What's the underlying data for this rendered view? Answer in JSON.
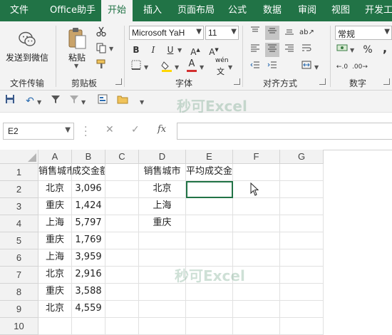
{
  "tabs": [
    {
      "label": "文件",
      "active": false
    },
    {
      "label": "Office助手",
      "active": false
    },
    {
      "label": "开始",
      "active": true
    },
    {
      "label": "插入",
      "active": false
    },
    {
      "label": "页面布局",
      "active": false
    },
    {
      "label": "公式",
      "active": false
    },
    {
      "label": "数据",
      "active": false
    },
    {
      "label": "审阅",
      "active": false
    },
    {
      "label": "视图",
      "active": false
    },
    {
      "label": "开发工",
      "active": false
    }
  ],
  "ribbon": {
    "send_to_wechat": "发送到微信",
    "file_transfer": "文件传输",
    "paste": "粘贴",
    "clipboard": "剪贴板",
    "font_name": "Microsoft YaH",
    "font_size": "11",
    "font_group": "字体",
    "bold": "B",
    "italic": "I",
    "underline": "U",
    "font_color_glyph": "A",
    "phonetic_label": "wén",
    "alignment_group": "对齐方式",
    "number_format": "常规",
    "percent": "%",
    "comma": ",",
    "number_group": "数字"
  },
  "watermark": "秒可Excel",
  "namebox": {
    "value": "E2"
  },
  "formula_bar": {
    "cancel": "✕",
    "enter": "✓",
    "fx": "fx",
    "value": ""
  },
  "columns": [
    "A",
    "B",
    "C",
    "D",
    "E",
    "F",
    "G"
  ],
  "rows": [
    "1",
    "2",
    "3",
    "4",
    "5",
    "6",
    "7",
    "8",
    "9",
    "10"
  ],
  "cells": [
    [
      "销售城市",
      "成交金额",
      "",
      "销售城市",
      "平均成交金额",
      "",
      ""
    ],
    [
      "北京",
      "3,096",
      "",
      "北京",
      "",
      "",
      ""
    ],
    [
      "重庆",
      "1,424",
      "",
      "上海",
      "",
      "",
      ""
    ],
    [
      "上海",
      "5,797",
      "",
      "重庆",
      "",
      "",
      ""
    ],
    [
      "重庆",
      "1,769",
      "",
      "",
      "",
      "",
      ""
    ],
    [
      "上海",
      "3,959",
      "",
      "",
      "",
      "",
      ""
    ],
    [
      "北京",
      "2,916",
      "",
      "",
      "",
      "",
      ""
    ],
    [
      "重庆",
      "3,588",
      "",
      "",
      "",
      "",
      ""
    ],
    [
      "北京",
      "4,559",
      "",
      "",
      "",
      "",
      ""
    ],
    [
      "",
      "",
      "",
      "",
      "",
      "",
      ""
    ]
  ],
  "selected_cell": "E2"
}
